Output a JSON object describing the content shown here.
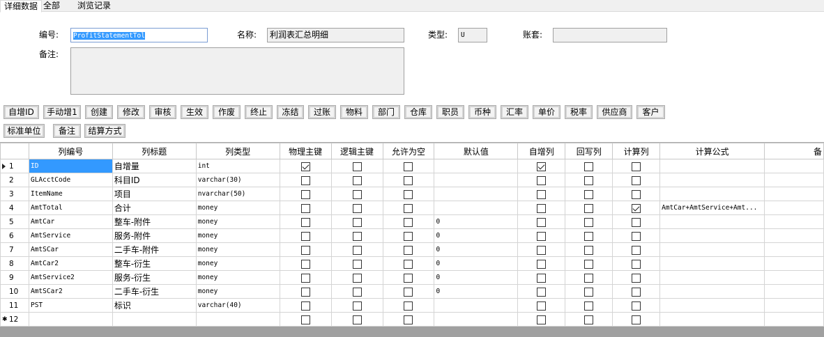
{
  "tabs": [
    "详细数据",
    "全部",
    "浏览记录"
  ],
  "form": {
    "code_label": "编号:",
    "code_value": "ProfitStatementTol",
    "name_label": "名称:",
    "name_value": "利润表汇总明细",
    "type_label": "类型:",
    "type_value": "U",
    "account_label": "账套:",
    "account_value": "",
    "remark_label": "备注:",
    "remark_value": ""
  },
  "toolbar_row1": [
    "自增ID",
    "手动增1",
    "创建",
    "修改",
    "审核",
    "生效",
    "作废",
    "终止",
    "冻结",
    "过账",
    "物料",
    "部门",
    "仓库",
    "职员",
    "币种",
    "汇率",
    "单价",
    "税率",
    "供应商",
    "客户"
  ],
  "toolbar_row2": [
    "标准单位",
    "备注",
    "结算方式"
  ],
  "grid": {
    "headers": [
      "列编号",
      "列标题",
      "列类型",
      "物理主键",
      "逻辑主键",
      "允许为空",
      "默认值",
      "自增列",
      "回写列",
      "计算列",
      "计算公式",
      "备"
    ],
    "rows": [
      {
        "num": "1",
        "code": "ID",
        "title": "自增量",
        "type": "int",
        "pk": true,
        "lk": false,
        "nullable": false,
        "default": "",
        "identity": true,
        "writeback": false,
        "computed": false,
        "formula": ""
      },
      {
        "num": "2",
        "code": "GLAcctCode",
        "title": "科目ID",
        "type": "varchar(30)",
        "pk": false,
        "lk": false,
        "nullable": false,
        "default": "",
        "identity": false,
        "writeback": false,
        "computed": false,
        "formula": ""
      },
      {
        "num": "3",
        "code": "ItemName",
        "title": "项目",
        "type": "nvarchar(50)",
        "pk": false,
        "lk": false,
        "nullable": false,
        "default": "",
        "identity": false,
        "writeback": false,
        "computed": false,
        "formula": ""
      },
      {
        "num": "4",
        "code": "AmtTotal",
        "title": "合计",
        "type": "money",
        "pk": false,
        "lk": false,
        "nullable": false,
        "default": "",
        "identity": false,
        "writeback": false,
        "computed": true,
        "formula": "AmtCar+AmtService+Amt..."
      },
      {
        "num": "5",
        "code": "AmtCar",
        "title": "整车-附件",
        "type": "money",
        "pk": false,
        "lk": false,
        "nullable": false,
        "default": "0",
        "identity": false,
        "writeback": false,
        "computed": false,
        "formula": ""
      },
      {
        "num": "6",
        "code": "AmtService",
        "title": "服务-附件",
        "type": "money",
        "pk": false,
        "lk": false,
        "nullable": false,
        "default": "0",
        "identity": false,
        "writeback": false,
        "computed": false,
        "formula": ""
      },
      {
        "num": "7",
        "code": "AmtSCar",
        "title": "二手车-附件",
        "type": "money",
        "pk": false,
        "lk": false,
        "nullable": false,
        "default": "0",
        "identity": false,
        "writeback": false,
        "computed": false,
        "formula": ""
      },
      {
        "num": "8",
        "code": "AmtCar2",
        "title": "整车-衍生",
        "type": "money",
        "pk": false,
        "lk": false,
        "nullable": false,
        "default": "0",
        "identity": false,
        "writeback": false,
        "computed": false,
        "formula": ""
      },
      {
        "num": "9",
        "code": "AmtService2",
        "title": "服务-衍生",
        "type": "money",
        "pk": false,
        "lk": false,
        "nullable": false,
        "default": "0",
        "identity": false,
        "writeback": false,
        "computed": false,
        "formula": ""
      },
      {
        "num": "10",
        "code": "AmtSCar2",
        "title": "二手车-衍生",
        "type": "money",
        "pk": false,
        "lk": false,
        "nullable": false,
        "default": "0",
        "identity": false,
        "writeback": false,
        "computed": false,
        "formula": ""
      },
      {
        "num": "11",
        "code": "PST",
        "title": "标识",
        "type": "varchar(40)",
        "pk": false,
        "lk": false,
        "nullable": false,
        "default": "",
        "identity": false,
        "writeback": false,
        "computed": false,
        "formula": ""
      },
      {
        "num": "12",
        "code": "",
        "title": "",
        "type": "",
        "pk": false,
        "lk": false,
        "nullable": false,
        "default": "",
        "identity": false,
        "writeback": false,
        "computed": false,
        "formula": "",
        "new_row": true
      }
    ]
  }
}
